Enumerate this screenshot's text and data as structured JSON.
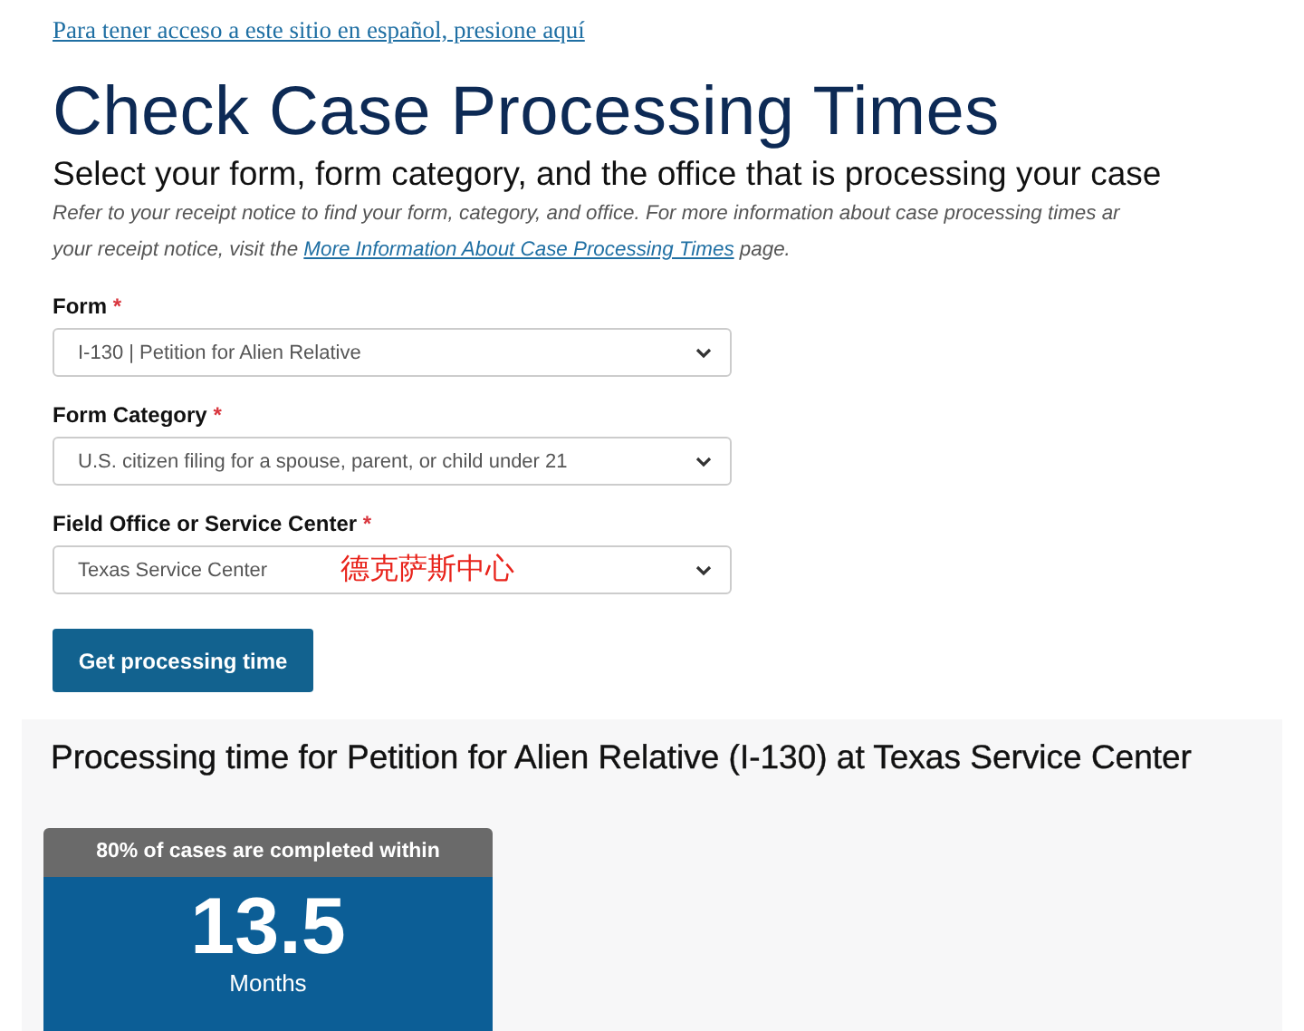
{
  "language_link": "Para tener acceso a este sitio en español, presione aquí",
  "title": "Check Case Processing Times",
  "subtitle": "Select your form, form category, and the office that is processing your case",
  "notice": {
    "line_1": "Refer to your receipt notice to find your form, category, and office. For more information about case processing times ar",
    "before_link": "your receipt notice, visit the ",
    "link": "More Information About Case Processing Times",
    "after_link": " page."
  },
  "fields": [
    {
      "label": "Form",
      "required_mark": "*",
      "value": "I-130 | Petition for Alien Relative"
    },
    {
      "label": "Form Category",
      "required_mark": "*",
      "value": "U.S. citizen filing for a spouse, parent, or child under 21"
    },
    {
      "label": "Field Office or Service Center",
      "required_mark": "*",
      "value": "Texas Service Center",
      "annotation": "德克萨斯中心"
    }
  ],
  "submit_button": "Get processing time",
  "result": {
    "heading": "Processing time for Petition for Alien Relative (I-130) at Texas Service Center",
    "card_header": "80% of cases are completed within",
    "value": "13.5",
    "unit": "Months"
  }
}
